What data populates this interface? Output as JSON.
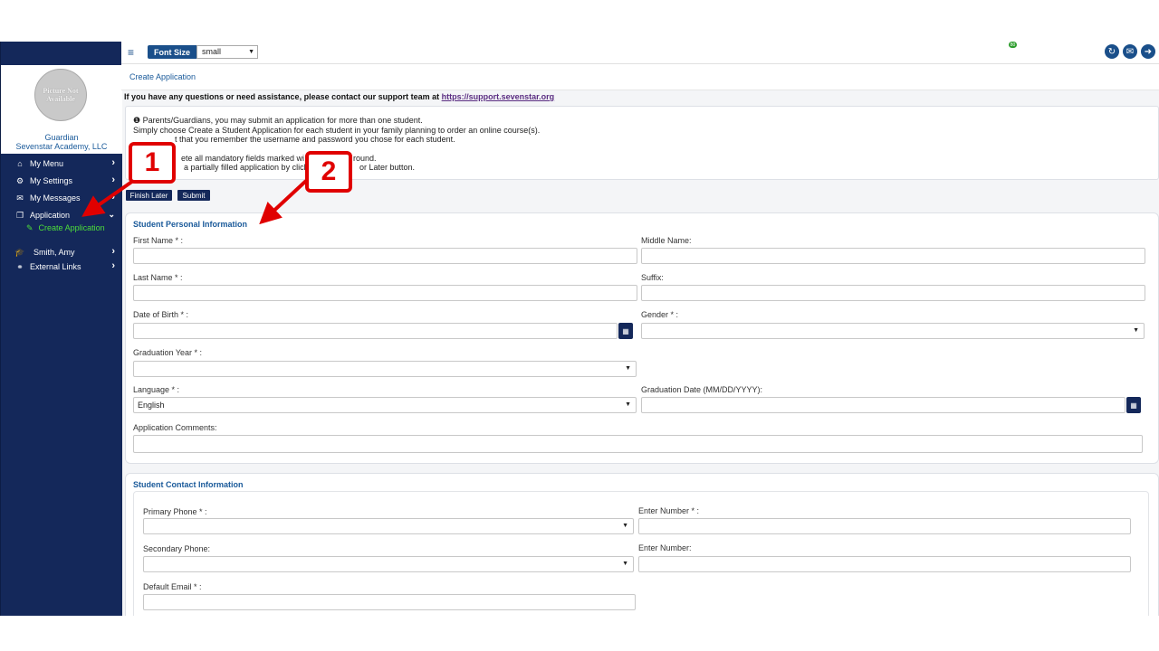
{
  "topbar": {
    "font_size_label": "Font Size",
    "font_size_value": "small",
    "notification_count": "80",
    "icons": [
      "menu-icon",
      "refresh-icon",
      "mail-icon",
      "logout-icon"
    ]
  },
  "sidebar": {
    "avatar_text": "Picture Not Available",
    "role": "Guardian",
    "organization": "Sevenstar Academy, LLC",
    "items": [
      {
        "label": "My Menu",
        "icon": "home-icon"
      },
      {
        "label": "My Settings",
        "icon": "gears-icon"
      },
      {
        "label": "My Messages",
        "icon": "comments-icon"
      },
      {
        "label": "Application",
        "icon": "copy-icon"
      },
      {
        "label": "Smith, Amy",
        "icon": "graduation-cap-icon"
      },
      {
        "label": "External Links",
        "icon": "link-icon"
      }
    ],
    "sub_item": "Create Application"
  },
  "breadcrumb": "Create Application",
  "support": {
    "text": "If you have any questions or need assistance, please contact our support team at",
    "link": "https://support.sevenstar.org"
  },
  "notice": {
    "line1": "Parents/Guardians, you may submit an application for more than one student.",
    "line2": "Simply choose Create a Student Application for each student in your family planning to order an online course(s).",
    "line3": "t that you remember the username and password you chose for each student.",
    "line4": "ete all mandatory fields marked wi",
    "line4b": "round.",
    "line5": "a partially filled application by click",
    "line5b": "or Later button."
  },
  "buttons": {
    "finish_later": "Finish Later",
    "submit": "Submit"
  },
  "personal": {
    "title": "Student Personal Information",
    "first_name": "First Name * :",
    "middle_name": "Middle Name:",
    "last_name": "Last Name * :",
    "suffix": "Suffix:",
    "dob": "Date of Birth * :",
    "gender": "Gender * :",
    "grad_year": "Graduation Year * :",
    "language": "Language * :",
    "language_value": "English",
    "grad_date": "Graduation Date (MM/DD/YYYY):",
    "comments": "Application Comments:"
  },
  "contact": {
    "title": "Student Contact Information",
    "primary_phone": "Primary Phone * :",
    "enter_number_req": "Enter Number * :",
    "secondary_phone": "Secondary Phone:",
    "enter_number": "Enter Number:",
    "default_email": "Default Email * :"
  },
  "callouts": [
    "1",
    "2"
  ],
  "colors": {
    "sidebar": "#14285a",
    "accent": "#1a4f8a",
    "callout": "#e00000",
    "active": "#4dde3a"
  }
}
